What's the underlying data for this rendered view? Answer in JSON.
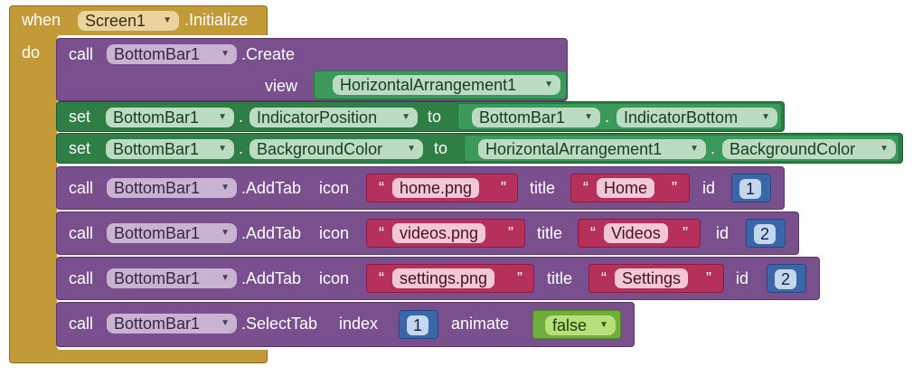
{
  "event": {
    "when": "when",
    "do": "do",
    "component": "Screen1",
    "event_name": ".Initialize"
  },
  "blocks": {
    "create": {
      "call": "call",
      "component": "BottomBar1",
      "method": ".Create",
      "arg_label": "view",
      "arg_value": "HorizontalArrangement1"
    },
    "set_indicator": {
      "set": "set",
      "component": "BottomBar1",
      "dot": ".",
      "property": "IndicatorPosition",
      "to": "to",
      "value_component": "BottomBar1",
      "value_property": "IndicatorBottom"
    },
    "set_bg": {
      "set": "set",
      "component": "BottomBar1",
      "dot": ".",
      "property": "BackgroundColor",
      "to": "to",
      "value_component": "HorizontalArrangement1",
      "value_property": "BackgroundColor"
    },
    "addtab1": {
      "call": "call",
      "component": "BottomBar1",
      "method": ".AddTab",
      "icon_label": "icon",
      "icon_value": "home.png",
      "title_label": "title",
      "title_value": "Home",
      "id_label": "id",
      "id_value": "1"
    },
    "addtab2": {
      "call": "call",
      "component": "BottomBar1",
      "method": ".AddTab",
      "icon_label": "icon",
      "icon_value": "videos.png",
      "title_label": "title",
      "title_value": "Videos",
      "id_label": "id",
      "id_value": "2"
    },
    "addtab3": {
      "call": "call",
      "component": "BottomBar1",
      "method": ".AddTab",
      "icon_label": "icon",
      "icon_value": "settings.png",
      "title_label": "title",
      "title_value": "Settings",
      "id_label": "id",
      "id_value": "2"
    },
    "selecttab": {
      "call": "call",
      "component": "BottomBar1",
      "method": ".SelectTab",
      "index_label": "index",
      "index_value": "1",
      "animate_label": "animate",
      "animate_value": "false"
    }
  },
  "glyphs": {
    "dropdown_arrow": "▼",
    "open_quote": "“",
    "close_quote": "”"
  },
  "colors": {
    "event": "#c39a38",
    "procedure": "#7a4f8d",
    "setter": "#2f7e45",
    "component_getter": "#3b9a5a",
    "text": "#b5305a",
    "math": "#3b66a8",
    "logic": "#6fae3a"
  }
}
